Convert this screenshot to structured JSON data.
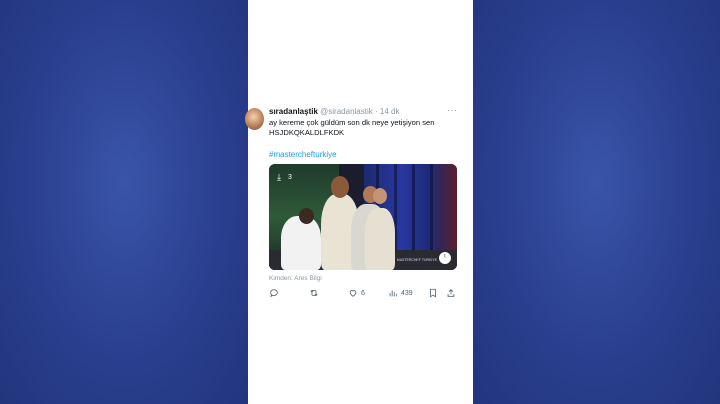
{
  "tweet": {
    "display_name": "sıradanlaştik",
    "handle": "@siradanlastik",
    "separator": "·",
    "time": "14 dk",
    "more": "···",
    "text_line1": "ay kereme çok güldüm son dk neye yetişiyon sen",
    "text_line2": "HSJDKQKALDLFKDK",
    "hashtag": "#masterchefturkiye",
    "from": "Kimden: Ares Bilgi"
  },
  "media": {
    "download_count": "3",
    "watermark": "MASTERCHEF TÜRKİYE",
    "logo": "ᵗ"
  },
  "actions": {
    "reply_count": "",
    "retweet_count": "",
    "like_count": "6",
    "views_count": "439"
  },
  "colors": {
    "background": "#2a3f8f",
    "card": "#ffffff",
    "link": "#1d9bf0",
    "secondary_text": "#8b98a5"
  }
}
